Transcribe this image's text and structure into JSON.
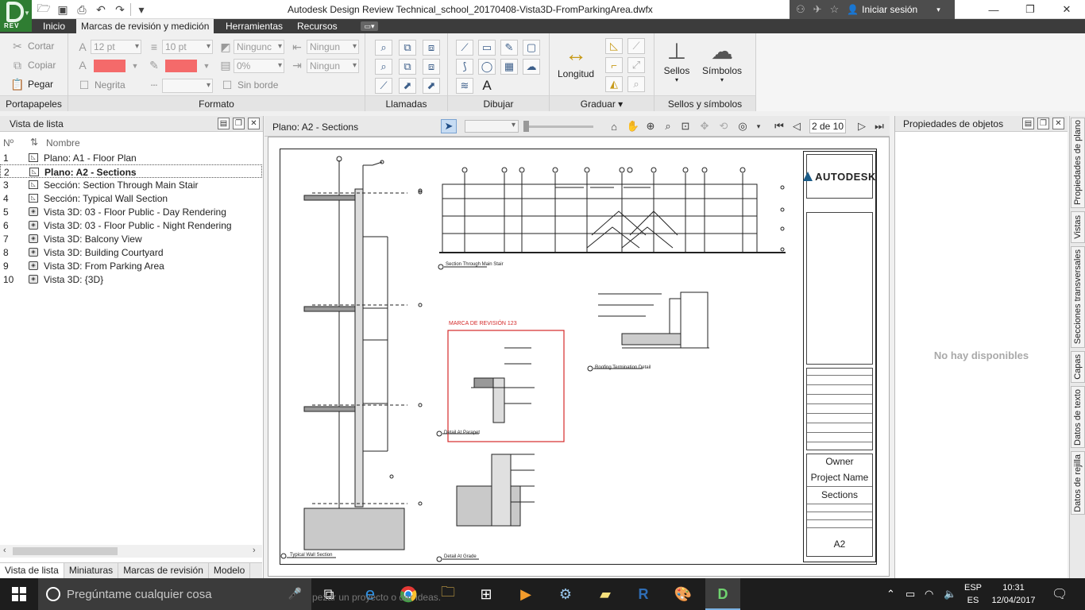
{
  "window": {
    "title": "Autodesk Design Review   Technical_school_20170408-Vista3D-FromParkingArea.dwfx",
    "app_badge": "REV",
    "signin": "Iniciar sesión"
  },
  "ribbon_tabs": [
    "Inicio",
    "Marcas de revisión y medición",
    "Herramientas",
    "Recursos"
  ],
  "ribbon": {
    "portapapeles": {
      "cut": "Cortar",
      "copy": "Copiar",
      "paste": "Pegar",
      "label": "Portapapeles"
    },
    "formato": {
      "font_size": "12 pt",
      "line_width": "10 pt",
      "fill": "Ningunc",
      "transparency": "0%",
      "start_arrow": "Ningun",
      "end_arrow": "Ningun",
      "bold": "Negrita",
      "no_border": "Sin borde",
      "label": "Formato",
      "swatch_color": "#f46a6a"
    },
    "llamadas": {
      "label": "Llamadas"
    },
    "dibujar": {
      "label": "Dibujar"
    },
    "graduar": {
      "length": "Longitud",
      "label": "Graduar"
    },
    "sellos": {
      "stamps": "Sellos",
      "symbols": "Símbolos",
      "label": "Sellos y símbolos"
    }
  },
  "list_panel": {
    "title": "Vista de lista",
    "col_num": "Nº",
    "col_name": "Nombre",
    "items": [
      {
        "num": "1",
        "label": "Plano: A1 - Floor Plan",
        "type": "sheet"
      },
      {
        "num": "2",
        "label": "Plano: A2 - Sections",
        "type": "sheet"
      },
      {
        "num": "3",
        "label": "Sección: Section Through Main Stair",
        "type": "sheet"
      },
      {
        "num": "4",
        "label": "Sección: Typical Wall Section",
        "type": "sheet"
      },
      {
        "num": "5",
        "label": "Vista 3D: 03 - Floor Public - Day Rendering",
        "type": "cube"
      },
      {
        "num": "6",
        "label": "Vista 3D: 03 - Floor Public - Night Rendering",
        "type": "cube"
      },
      {
        "num": "7",
        "label": "Vista 3D: Balcony View",
        "type": "cube"
      },
      {
        "num": "8",
        "label": "Vista 3D: Building Courtyard",
        "type": "cube"
      },
      {
        "num": "9",
        "label": "Vista 3D: From Parking Area",
        "type": "cube"
      },
      {
        "num": "10",
        "label": "Vista 3D: {3D}",
        "type": "cube"
      }
    ],
    "tabs": [
      "Vista de lista",
      "Miniaturas",
      "Marcas de revisión",
      "Modelo"
    ]
  },
  "canvas": {
    "title": "Plano: A2 - Sections",
    "page": "2 de 10",
    "markup_label": "MARCA DE REVISIÓN 123",
    "views": {
      "main_stair": "Section Through Main Stair",
      "roofing": "Roofing Termination Detail",
      "parapet": "Detail At Parapet",
      "grade": "Detail At Grade",
      "wall": "Typical Wall Section"
    },
    "titleblock": {
      "logo": "AUTODESK",
      "owner": "Owner",
      "project": "Project Name",
      "sheet_name": "Sections",
      "sheet_num": "A2"
    }
  },
  "props_panel": {
    "title": "Propiedades de objetos",
    "empty": "No hay disponibles"
  },
  "side_tabs": [
    "Propiedades de plano",
    "Vistas",
    "Secciones transversales",
    "Capas",
    "Datos de texto",
    "Datos de rejilla"
  ],
  "taskbar": {
    "search_placeholder": "Pregúntame cualquier cosa",
    "lang1": "ESP",
    "lang2": "ES",
    "time": "10:31",
    "date": "12/04/2017",
    "ghost": "pezar un proyecto o dar ideas."
  }
}
